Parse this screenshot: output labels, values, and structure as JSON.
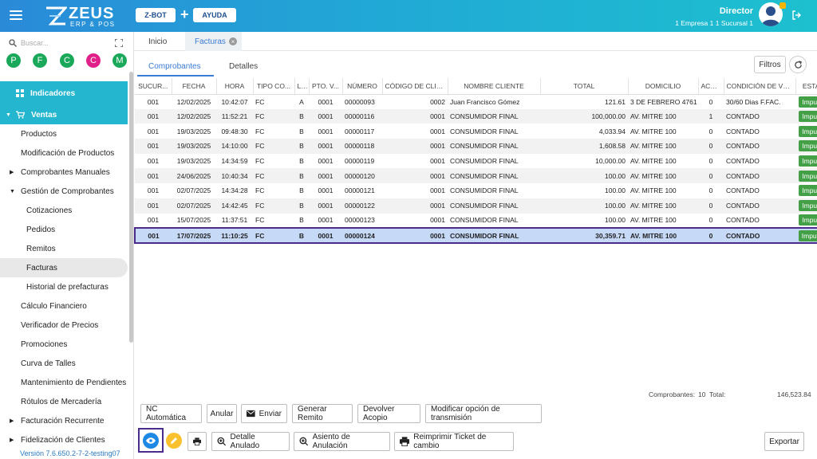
{
  "header": {
    "logo_title": "ZEUS",
    "logo_sub": "ERP & POS",
    "zbot_label": "Z-BOT",
    "plus_label": "+",
    "ayuda_label": "AYUDA",
    "user_name": "Director",
    "user_meta": "1 Empresa 1     1 Sucursal 1"
  },
  "sidebar": {
    "search_placeholder": "Buscar...",
    "quick": [
      {
        "letter": "P",
        "color": "#1aa85a"
      },
      {
        "letter": "F",
        "color": "#1aa85a"
      },
      {
        "letter": "C",
        "color": "#1aa85a"
      },
      {
        "letter": "C",
        "color": "#e0218a"
      },
      {
        "letter": "M",
        "color": "#1aa85a"
      }
    ],
    "items": [
      {
        "label": "Indicadores"
      },
      {
        "label": "Ventas"
      },
      {
        "label": "Productos"
      },
      {
        "label": "Modificación de Productos"
      },
      {
        "label": "Comprobantes Manuales"
      },
      {
        "label": "Gestión de Comprobantes"
      },
      {
        "label": "Cotizaciones"
      },
      {
        "label": "Pedidos"
      },
      {
        "label": "Remitos"
      },
      {
        "label": "Facturas"
      },
      {
        "label": "Historial de prefacturas"
      },
      {
        "label": "Cálculo Financiero"
      },
      {
        "label": "Verificador de Precios"
      },
      {
        "label": "Promociones"
      },
      {
        "label": "Curva de Talles"
      },
      {
        "label": "Mantenimiento de Pendientes"
      },
      {
        "label": "Rótulos de Mercadería"
      },
      {
        "label": "Facturación Recurrente"
      },
      {
        "label": "Fidelización de Clientes"
      }
    ],
    "version": "Versión 7.6.650.2-7-2-testing07"
  },
  "tabs": {
    "inicio": "Inicio",
    "facturas": "Facturas",
    "comprobantes": "Comprobantes",
    "detalles": "Detalles",
    "filtros": "Filtros"
  },
  "table": {
    "headers": [
      "SUCUR...",
      "FECHA",
      "HORA",
      "TIPO CO...",
      "L...",
      "PTO. V...",
      "NÚMERO",
      "CÓDIGO DE CLIEN...",
      "NOMBRE CLIENTE",
      "TOTAL",
      "DOMICILIO",
      "ACO...",
      "CONDICIÓN DE VEN...",
      "ESTADO"
    ],
    "rows": [
      [
        "001",
        "12/02/2025",
        "10:42:07",
        "FC",
        "A",
        "0001",
        "00000093",
        "0002",
        "Juan Francisco Gómez",
        "121.61",
        "3 DE FEBRERO 4761",
        "0",
        "30/60 Dias F.FAC.",
        "Imputado"
      ],
      [
        "001",
        "12/02/2025",
        "11:52:21",
        "FC",
        "B",
        "0001",
        "00000116",
        "0001",
        "CONSUMIDOR FINAL",
        "100,000.00",
        "AV. MITRE 100",
        "1",
        "CONTADO",
        "Imputado"
      ],
      [
        "001",
        "19/03/2025",
        "09:48:30",
        "FC",
        "B",
        "0001",
        "00000117",
        "0001",
        "CONSUMIDOR FINAL",
        "4,033.94",
        "AV. MITRE 100",
        "0",
        "CONTADO",
        "Imputado"
      ],
      [
        "001",
        "19/03/2025",
        "14:10:00",
        "FC",
        "B",
        "0001",
        "00000118",
        "0001",
        "CONSUMIDOR FINAL",
        "1,608.58",
        "AV. MITRE 100",
        "0",
        "CONTADO",
        "Imputado"
      ],
      [
        "001",
        "19/03/2025",
        "14:34:59",
        "FC",
        "B",
        "0001",
        "00000119",
        "0001",
        "CONSUMIDOR FINAL",
        "10,000.00",
        "AV. MITRE 100",
        "0",
        "CONTADO",
        "Imputado"
      ],
      [
        "001",
        "24/06/2025",
        "10:40:34",
        "FC",
        "B",
        "0001",
        "00000120",
        "0001",
        "CONSUMIDOR FINAL",
        "100.00",
        "AV. MITRE 100",
        "0",
        "CONTADO",
        "Imputado"
      ],
      [
        "001",
        "02/07/2025",
        "14:34:28",
        "FC",
        "B",
        "0001",
        "00000121",
        "0001",
        "CONSUMIDOR FINAL",
        "100.00",
        "AV. MITRE 100",
        "0",
        "CONTADO",
        "Imputado"
      ],
      [
        "001",
        "02/07/2025",
        "14:42:45",
        "FC",
        "B",
        "0001",
        "00000122",
        "0001",
        "CONSUMIDOR FINAL",
        "100.00",
        "AV. MITRE 100",
        "0",
        "CONTADO",
        "Imputado"
      ],
      [
        "001",
        "15/07/2025",
        "11:37:51",
        "FC",
        "B",
        "0001",
        "00000123",
        "0001",
        "CONSUMIDOR FINAL",
        "100.00",
        "AV. MITRE 100",
        "0",
        "CONTADO",
        "Imputado"
      ],
      [
        "001",
        "17/07/2025",
        "11:10:25",
        "FC",
        "B",
        "0001",
        "00000124",
        "0001",
        "CONSUMIDOR FINAL",
        "30,359.71",
        "AV. MITRE 100",
        "0",
        "CONTADO",
        "Imputado"
      ]
    ]
  },
  "summary": {
    "comprobantes_label": "Comprobantes:",
    "comprobantes_count": "10",
    "total_label": "Total:",
    "total_value": "146,523.84"
  },
  "actions": {
    "nc_automatica": "NC Automática",
    "anular": "Anular",
    "enviar": "Enviar",
    "generar_remito": "Generar Remito",
    "devolver_acopio": "Devolver Acopio",
    "modificar_transmision": "Modificar opción de transmisión",
    "detalle_anulado": "Detalle Anulado",
    "asiento_anulacion": "Asiento de Anulación",
    "reimprimir_ticket": "Reimprimir Ticket de cambio",
    "exportar": "Exportar"
  },
  "colors": {
    "header_start": "#2a8ad8",
    "header_end": "#1dc0cf",
    "active_menu": "#24b5cf",
    "status_green": "#43a047",
    "selected_row": "#c6d9f7",
    "focus_border": "#4b2c8a"
  }
}
